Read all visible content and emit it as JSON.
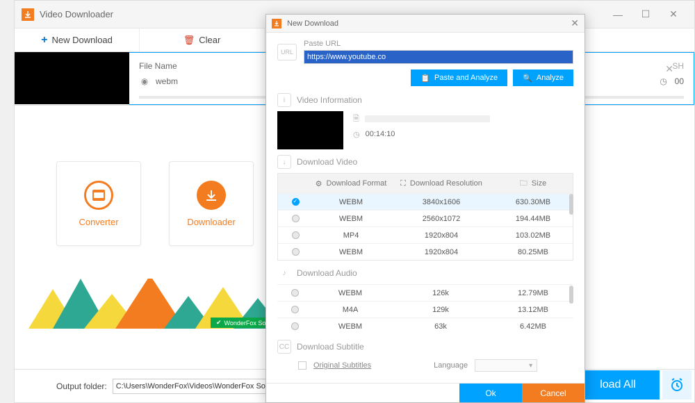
{
  "main": {
    "title": "Video Downloader",
    "toolbar": {
      "new_download": "New Download",
      "clear": "Clear"
    },
    "row": {
      "filename_label": "File Name",
      "format": "webm",
      "time_prefix": "00"
    },
    "modules": {
      "converter": "Converter",
      "downloader": "Downloader"
    },
    "wfs": "WonderFox Soft",
    "output": {
      "label": "Output folder:",
      "path": "C:\\Users\\WonderFox\\Videos\\WonderFox Soft\\HD Video Conv"
    },
    "load_all": "load All"
  },
  "dialog": {
    "title": "New Download",
    "paste_url_label": "Paste URL",
    "url": "https://www.youtube.co",
    "paste_analyze": "Paste and Analyze",
    "analyze": "Analyze",
    "video_info_label": "Video Information",
    "duration": "00:14:10",
    "download_video_label": "Download Video",
    "headers": {
      "format": "Download Format",
      "resolution": "Download Resolution",
      "size": "Size"
    },
    "video_rows": [
      {
        "selected": true,
        "format": "WEBM",
        "res": "3840x1606",
        "size": "630.30MB"
      },
      {
        "selected": false,
        "format": "WEBM",
        "res": "2560x1072",
        "size": "194.44MB"
      },
      {
        "selected": false,
        "format": "MP4",
        "res": "1920x804",
        "size": "103.02MB"
      },
      {
        "selected": false,
        "format": "WEBM",
        "res": "1920x804",
        "size": "80.25MB"
      }
    ],
    "download_audio_label": "Download Audio",
    "audio_rows": [
      {
        "format": "WEBM",
        "res": "126k",
        "size": "12.79MB"
      },
      {
        "format": "M4A",
        "res": "129k",
        "size": "13.12MB"
      },
      {
        "format": "WEBM",
        "res": "63k",
        "size": "6.42MB"
      }
    ],
    "download_subtitle_label": "Download Subtitle",
    "original_subtitles": "Original Subtitles",
    "language_label": "Language",
    "ok": "Ok",
    "cancel": "Cancel"
  }
}
